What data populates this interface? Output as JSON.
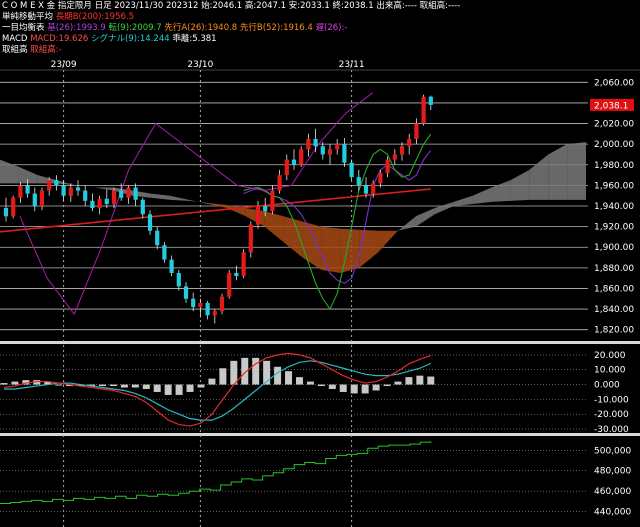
{
  "header": {
    "line1": "C O M E X 金 指定限月 日足 2023/11/30 202312 始:2046.1 高:2047.1 安:2033.1 終:2038.1 出来高:---- 取組高:----",
    "sma_label": "単純移動平均",
    "sma_value": "長期B(200):1956.5",
    "ichimoku_label": "一目均衡表",
    "kijun": "基(26):1993.9",
    "tenkan": "転(9):2009.7",
    "senkouA": "先行A(26):1940.8",
    "senkouB": "先行B(52):1916.4",
    "chikou": "遅(26):-",
    "macd_label": "MACD",
    "macd_value": "MACD:19.626",
    "signal_value": "シグナル(9):14.244",
    "osc_value": "乖離:5.381",
    "oi_label": "取組高",
    "oi_value": "取組高:-"
  },
  "colors": {
    "up": "#e51a1a",
    "down": "#22cde0",
    "cloud_bull": "#7a7a7a",
    "cloud_bear": "#a84a14",
    "sma": "#d81e1e",
    "kijun": "#7b2fcf",
    "tenkan": "#29a829",
    "chikou": "#a81fa8",
    "macd": "#e02b2b",
    "signal": "#29b8c4",
    "osc": "#c8c8c8",
    "oi": "#27c427"
  },
  "chart_data": [
    {
      "type": "candlestick",
      "x_labels": [
        "23/09",
        "23/10",
        "23/11"
      ],
      "ylim": [
        1810,
        2070
      ],
      "yticks": [
        1820,
        1840,
        1860,
        1880,
        1900,
        1920,
        1940,
        1960,
        1980,
        2000,
        2020,
        2040,
        2060
      ],
      "last_price_label": "2,038.1",
      "last_price": 2038.1,
      "ohlc": [
        [
          1938,
          1948,
          1925,
          1930
        ],
        [
          1930,
          1950,
          1928,
          1948
        ],
        [
          1948,
          1963,
          1943,
          1960
        ],
        [
          1960,
          1966,
          1948,
          1952
        ],
        [
          1952,
          1958,
          1935,
          1940
        ],
        [
          1940,
          1958,
          1936,
          1955
        ],
        [
          1955,
          1968,
          1950,
          1965
        ],
        [
          1965,
          1970,
          1955,
          1960
        ],
        [
          1960,
          1965,
          1945,
          1950
        ],
        [
          1950,
          1962,
          1944,
          1958
        ],
        [
          1958,
          1965,
          1950,
          1955
        ],
        [
          1955,
          1960,
          1940,
          1945
        ],
        [
          1945,
          1952,
          1935,
          1938
        ],
        [
          1938,
          1950,
          1932,
          1947
        ],
        [
          1947,
          1956,
          1938,
          1942
        ],
        [
          1942,
          1958,
          1938,
          1955
        ],
        [
          1955,
          1962,
          1945,
          1948
        ],
        [
          1948,
          1960,
          1942,
          1958
        ],
        [
          1958,
          1962,
          1940,
          1946
        ],
        [
          1946,
          1948,
          1928,
          1932
        ],
        [
          1932,
          1936,
          1912,
          1916
        ],
        [
          1916,
          1920,
          1898,
          1902
        ],
        [
          1902,
          1905,
          1885,
          1888
        ],
        [
          1888,
          1892,
          1872,
          1875
        ],
        [
          1875,
          1878,
          1858,
          1862
        ],
        [
          1862,
          1866,
          1846,
          1850
        ],
        [
          1850,
          1856,
          1838,
          1842
        ],
        [
          1842,
          1850,
          1832,
          1846
        ],
        [
          1846,
          1848,
          1830,
          1834
        ],
        [
          1834,
          1840,
          1826,
          1838
        ],
        [
          1838,
          1855,
          1835,
          1852
        ],
        [
          1852,
          1878,
          1850,
          1875
        ],
        [
          1875,
          1882,
          1868,
          1872
        ],
        [
          1872,
          1898,
          1870,
          1895
        ],
        [
          1895,
          1925,
          1890,
          1922
        ],
        [
          1922,
          1945,
          1918,
          1940
        ],
        [
          1940,
          1948,
          1930,
          1935
        ],
        [
          1935,
          1960,
          1932,
          1955
        ],
        [
          1955,
          1975,
          1952,
          1970
        ],
        [
          1970,
          1990,
          1965,
          1985
        ],
        [
          1985,
          1995,
          1975,
          1980
        ],
        [
          1980,
          1998,
          1978,
          1995
        ],
        [
          1995,
          2010,
          1988,
          2005
        ],
        [
          2005,
          2015,
          1992,
          1998
        ],
        [
          1998,
          2002,
          1985,
          1990
        ],
        [
          1990,
          2000,
          1980,
          1995
        ],
        [
          1995,
          2005,
          1990,
          2000
        ],
        [
          2000,
          2006,
          1978,
          1982
        ],
        [
          1982,
          1985,
          1965,
          1968
        ],
        [
          1968,
          1975,
          1955,
          1960
        ],
        [
          1960,
          1968,
          1948,
          1952
        ],
        [
          1952,
          1965,
          1948,
          1962
        ],
        [
          1962,
          1975,
          1958,
          1972
        ],
        [
          1972,
          1988,
          1968,
          1985
        ],
        [
          1985,
          1995,
          1980,
          1990
        ],
        [
          1990,
          2002,
          1984,
          1998
        ],
        [
          1998,
          2010,
          1990,
          2005
        ],
        [
          2005,
          2025,
          2000,
          2020
        ],
        [
          2020,
          2048,
          2018,
          2046
        ],
        [
          2046,
          2047.1,
          2033.1,
          2038.1
        ]
      ],
      "sma200": [
        1915,
        1956.5
      ],
      "kijun": [
        1952,
        1955,
        1957,
        1954,
        1950,
        1948,
        1945,
        1940,
        1932,
        1920,
        1905,
        1890,
        1875,
        1868,
        1865,
        1870,
        1890,
        1925,
        1960,
        1975,
        1980,
        1975,
        1970,
        1965,
        1970,
        1985,
        1993.9
      ],
      "tenkan": [
        1955,
        1957,
        1958,
        1955,
        1950,
        1948,
        1940,
        1925,
        1905,
        1885,
        1865,
        1850,
        1840,
        1855,
        1885,
        1920,
        1955,
        1975,
        1990,
        1995,
        1990,
        1975,
        1968,
        1970,
        1985,
        2000,
        2009.7
      ],
      "chikou": [
        1930,
        1870,
        1835,
        1900,
        1975,
        2020,
        2000,
        1980,
        1960,
        1955,
        1960,
        2000,
        2030,
        2050
      ],
      "cloudA": [
        1985,
        1978,
        1970,
        1965,
        1960,
        1958,
        1958,
        1955,
        1952,
        1950,
        1946,
        1942,
        1938,
        1930,
        1920,
        1905,
        1890,
        1878,
        1875,
        1880,
        1895,
        1915,
        1930,
        1938,
        1944,
        1950,
        1958,
        1965,
        1975,
        1990,
        2000,
        2002
      ],
      "cloudB": [
        1962,
        1962,
        1962,
        1962,
        1960,
        1958,
        1955,
        1950,
        1948,
        1946,
        1945,
        1943,
        1941,
        1938,
        1935,
        1930,
        1925,
        1920,
        1918,
        1917,
        1916,
        1916,
        1920,
        1932,
        1940,
        1942,
        1944,
        1945,
        1946,
        1946,
        1946,
        1946
      ]
    },
    {
      "type": "line",
      "name": "MACD",
      "ylim": [
        -32,
        26
      ],
      "yticks": [
        20,
        10,
        0,
        -10,
        -20,
        -30
      ],
      "ytick_labels": [
        "20.000",
        "10.000",
        "0.000",
        "-10.000",
        "-20.000",
        "-30.000"
      ],
      "macd": [
        -2,
        -1,
        1,
        2,
        2,
        1,
        0,
        -1,
        -2,
        -3,
        -4,
        -6,
        -8,
        -12,
        -18,
        -24,
        -27,
        -28,
        -26,
        -20,
        -10,
        0,
        8,
        14,
        18,
        20,
        21,
        20,
        18,
        14,
        10,
        6,
        3,
        1,
        2,
        5,
        9,
        14,
        17,
        19.6
      ],
      "signal": [
        -3,
        -3,
        -2,
        -1,
        0,
        1,
        1,
        0,
        -1,
        -2,
        -3,
        -4,
        -6,
        -9,
        -13,
        -17,
        -20,
        -23,
        -24,
        -24,
        -21,
        -16,
        -10,
        -4,
        2,
        8,
        12,
        15,
        16,
        15,
        13,
        11,
        9,
        7,
        6,
        6,
        7,
        9,
        11,
        14.2
      ],
      "osc": [
        1,
        2,
        3,
        3,
        2,
        0,
        -1,
        -1,
        -1,
        -1,
        -1,
        -2,
        -2,
        -3,
        -5,
        -7,
        -7,
        -5,
        -2,
        4,
        11,
        16,
        18,
        18,
        16,
        12,
        9,
        5,
        2,
        -1,
        -3,
        -5,
        -6,
        -6,
        -4,
        -1,
        2,
        5,
        6,
        5.4
      ]
    },
    {
      "type": "line",
      "name": "取組高",
      "ylim": [
        425000,
        512000
      ],
      "yticks": [
        500000,
        480000,
        460000,
        440000
      ],
      "ytick_labels": [
        "500,000",
        "480,000",
        "460,000",
        "440,000"
      ],
      "values": [
        448000,
        449000,
        450000,
        451000,
        450000,
        452000,
        451000,
        453000,
        452000,
        454000,
        453000,
        455000,
        453000,
        456000,
        455000,
        457000,
        456000,
        458000,
        460000,
        462000,
        461000,
        466000,
        469000,
        472000,
        471000,
        475000,
        478000,
        482000,
        486000,
        488000,
        487000,
        492000,
        495000,
        496000,
        497000,
        502000,
        504000,
        505000,
        505000,
        506000,
        508000,
        509000
      ]
    }
  ]
}
